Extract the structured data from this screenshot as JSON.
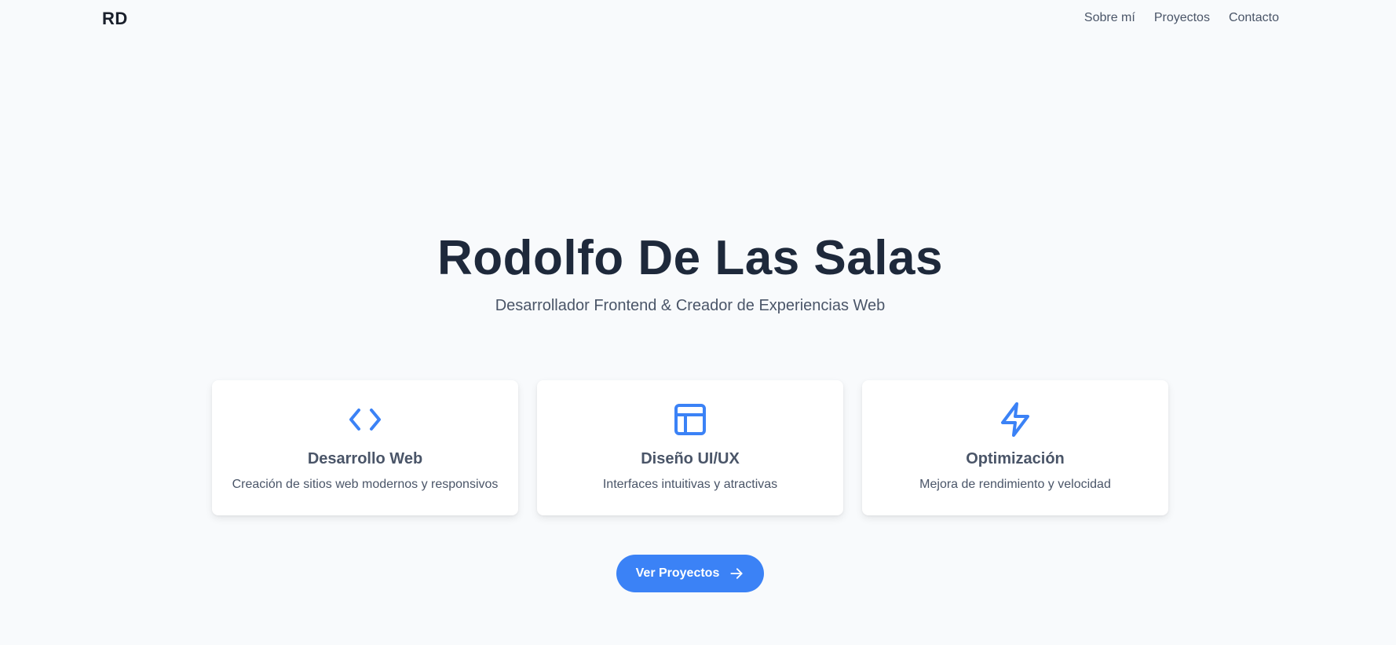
{
  "nav": {
    "logo": "RD",
    "links": [
      "Sobre mí",
      "Proyectos",
      "Contacto"
    ]
  },
  "hero": {
    "title": "Rodolfo De Las Salas",
    "subtitle": "Desarrollador Frontend & Creador de Experiencias Web"
  },
  "cards": [
    {
      "icon": "code-icon",
      "title": "Desarrollo Web",
      "description": "Creación de sitios web modernos y responsivos"
    },
    {
      "icon": "layout-icon",
      "title": "Diseño UI/UX",
      "description": "Interfaces intuitivas y atractivas"
    },
    {
      "icon": "lightning-icon",
      "title": "Optimización",
      "description": "Mejora de rendimiento y velocidad"
    }
  ],
  "cta": {
    "label": "Ver Proyectos",
    "icon": "arrow-right-icon"
  },
  "colors": {
    "accent": "#3b82f6",
    "background": "#f8fafc",
    "heading": "#1e293b",
    "text": "#4a5568"
  }
}
